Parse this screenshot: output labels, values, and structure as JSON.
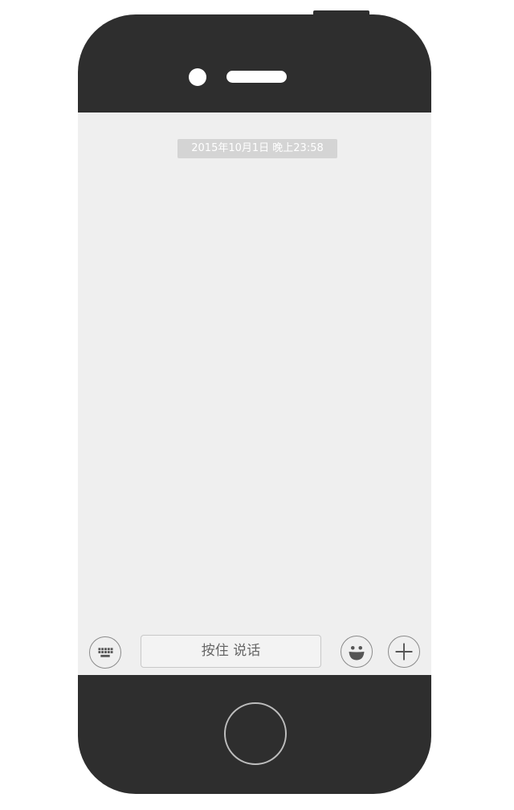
{
  "chat": {
    "timestamp": "2015年10月1日 晚上23:58"
  },
  "input_bar": {
    "hold_to_talk_label": "按住 说话",
    "keyboard_icon": "keyboard-icon",
    "emoji_icon": "smiley-face-icon",
    "plus_icon": "plus-icon"
  },
  "colors": {
    "phone_body": "#2e2e2e",
    "screen_background": "#efefef",
    "timestamp_background": "#d4d4d4"
  }
}
